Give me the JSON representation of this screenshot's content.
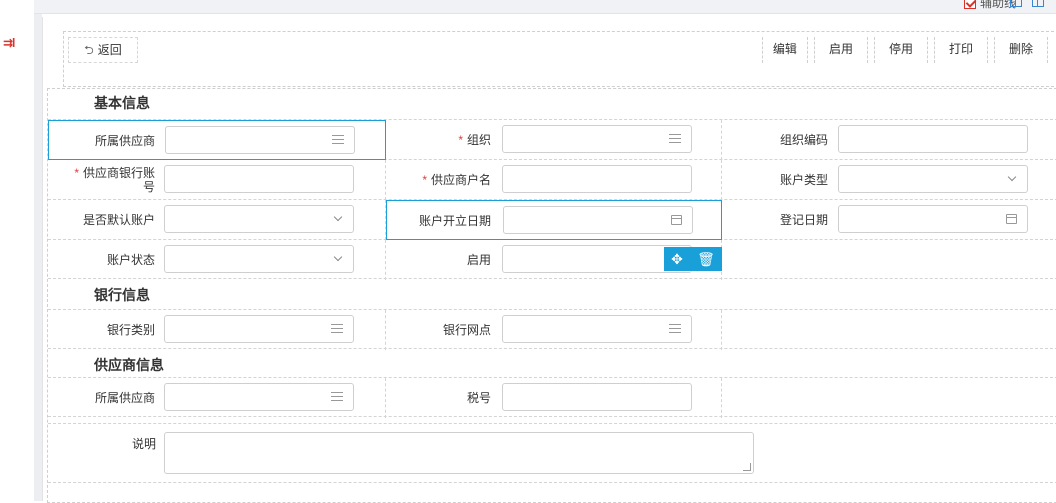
{
  "top_bar": {
    "aux_label": "辅助线"
  },
  "toolbar": {
    "back_label": "返回",
    "actions": [
      "编辑",
      "启用",
      "停用",
      "打印",
      "删除"
    ]
  },
  "sections": {
    "basic": "基本信息",
    "bank": "银行信息",
    "supplier": "供应商信息"
  },
  "fields": {
    "supplier": "所属供应商",
    "org": "组织",
    "org_code": "组织编码",
    "bank_account_line1": "供应商银行账",
    "bank_account_line2": "号",
    "account_name": "供应商户名",
    "account_type": "账户类型",
    "is_default": "是否默认账户",
    "open_date": "账户开立日期",
    "register_date": "登记日期",
    "account_status": "账户状态",
    "enabled": "启用",
    "bank_category": "银行类别",
    "bank_branch": "银行网点",
    "supplier2": "所属供应商",
    "tax_no": "税号",
    "remark": "说明"
  },
  "required_mark": "*",
  "colors": {
    "accent": "#1aa0d8",
    "required": "#e03c3c"
  }
}
